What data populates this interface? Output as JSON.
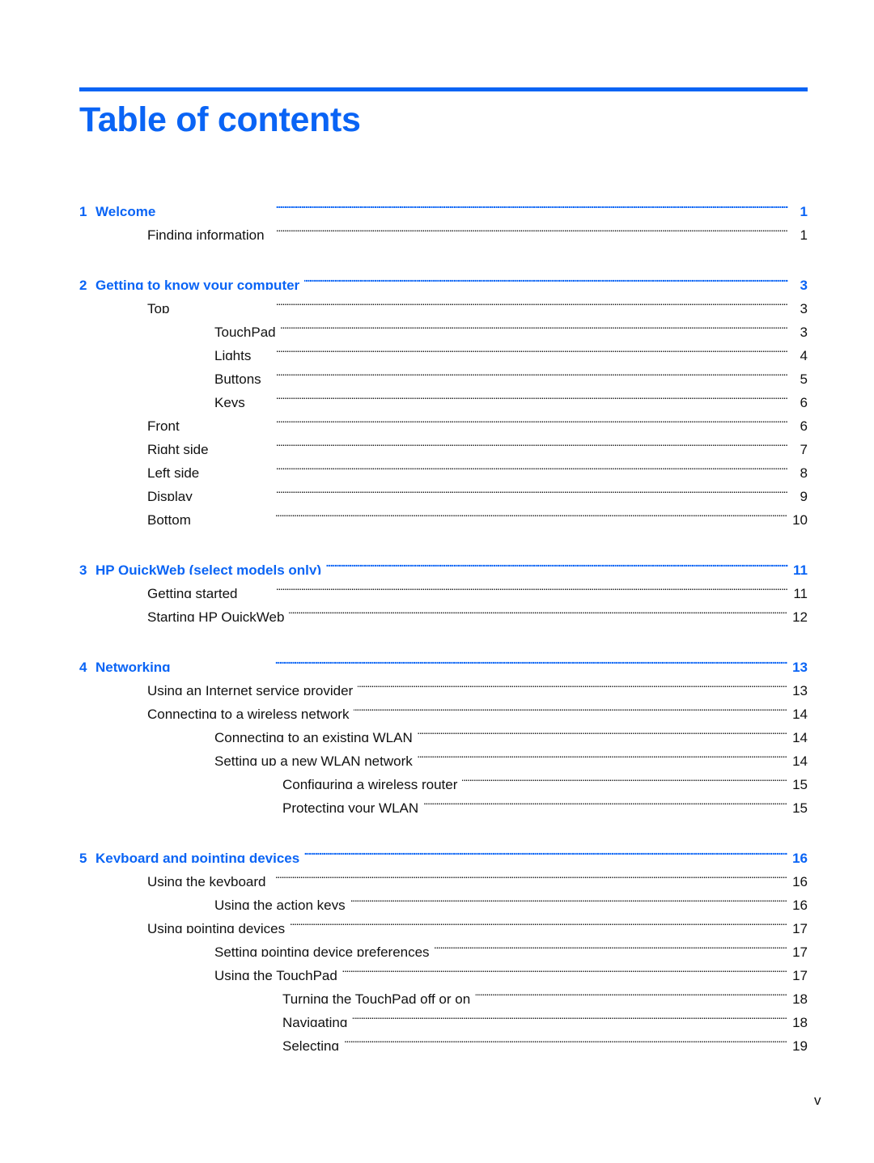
{
  "title": "Table of contents",
  "accent_color": "#0a64f5",
  "folio": "v",
  "entries": [
    {
      "level": 0,
      "num": "1",
      "label": "Welcome",
      "page": "1"
    },
    {
      "level": 1,
      "label": "Finding information",
      "page": "1"
    },
    {
      "level": 0,
      "num": "2",
      "label": "Getting to know your computer",
      "page": "3"
    },
    {
      "level": 1,
      "label": "Top",
      "page": "3"
    },
    {
      "level": 2,
      "label": "TouchPad",
      "page": "3"
    },
    {
      "level": 2,
      "label": "Lights",
      "page": "4"
    },
    {
      "level": 2,
      "label": "Buttons",
      "page": "5"
    },
    {
      "level": 2,
      "label": "Keys",
      "page": "6"
    },
    {
      "level": 1,
      "label": "Front",
      "page": "6"
    },
    {
      "level": 1,
      "label": "Right side",
      "page": "7"
    },
    {
      "level": 1,
      "label": "Left side",
      "page": "8"
    },
    {
      "level": 1,
      "label": "Display",
      "page": "9"
    },
    {
      "level": 1,
      "label": "Bottom",
      "page": "10"
    },
    {
      "level": 0,
      "num": "3",
      "label": "HP QuickWeb (select models only)",
      "page": "11"
    },
    {
      "level": 1,
      "label": "Getting started",
      "page": "11"
    },
    {
      "level": 1,
      "label": "Starting HP QuickWeb",
      "page": "12"
    },
    {
      "level": 0,
      "num": "4",
      "label": "Networking",
      "page": "13"
    },
    {
      "level": 1,
      "label": "Using an Internet service provider",
      "page": "13"
    },
    {
      "level": 1,
      "label": "Connecting to a wireless network",
      "page": "14"
    },
    {
      "level": 2,
      "label": "Connecting to an existing WLAN",
      "page": "14"
    },
    {
      "level": 2,
      "label": "Setting up a new WLAN network",
      "page": "14"
    },
    {
      "level": 3,
      "label": "Configuring a wireless router",
      "page": "15"
    },
    {
      "level": 3,
      "label": "Protecting your WLAN",
      "page": "15"
    },
    {
      "level": 0,
      "num": "5",
      "label": "Keyboard and pointing devices",
      "page": "16"
    },
    {
      "level": 1,
      "label": "Using the keyboard",
      "page": "16"
    },
    {
      "level": 2,
      "label": "Using the action keys",
      "page": "16"
    },
    {
      "level": 1,
      "label": "Using pointing devices",
      "page": "17"
    },
    {
      "level": 2,
      "label": "Setting pointing device preferences",
      "page": "17"
    },
    {
      "level": 2,
      "label": "Using the TouchPad",
      "page": "17"
    },
    {
      "level": 3,
      "label": "Turning the TouchPad off or on",
      "page": "18"
    },
    {
      "level": 3,
      "label": "Navigating",
      "page": "18"
    },
    {
      "level": 3,
      "label": "Selecting",
      "page": "19"
    }
  ]
}
